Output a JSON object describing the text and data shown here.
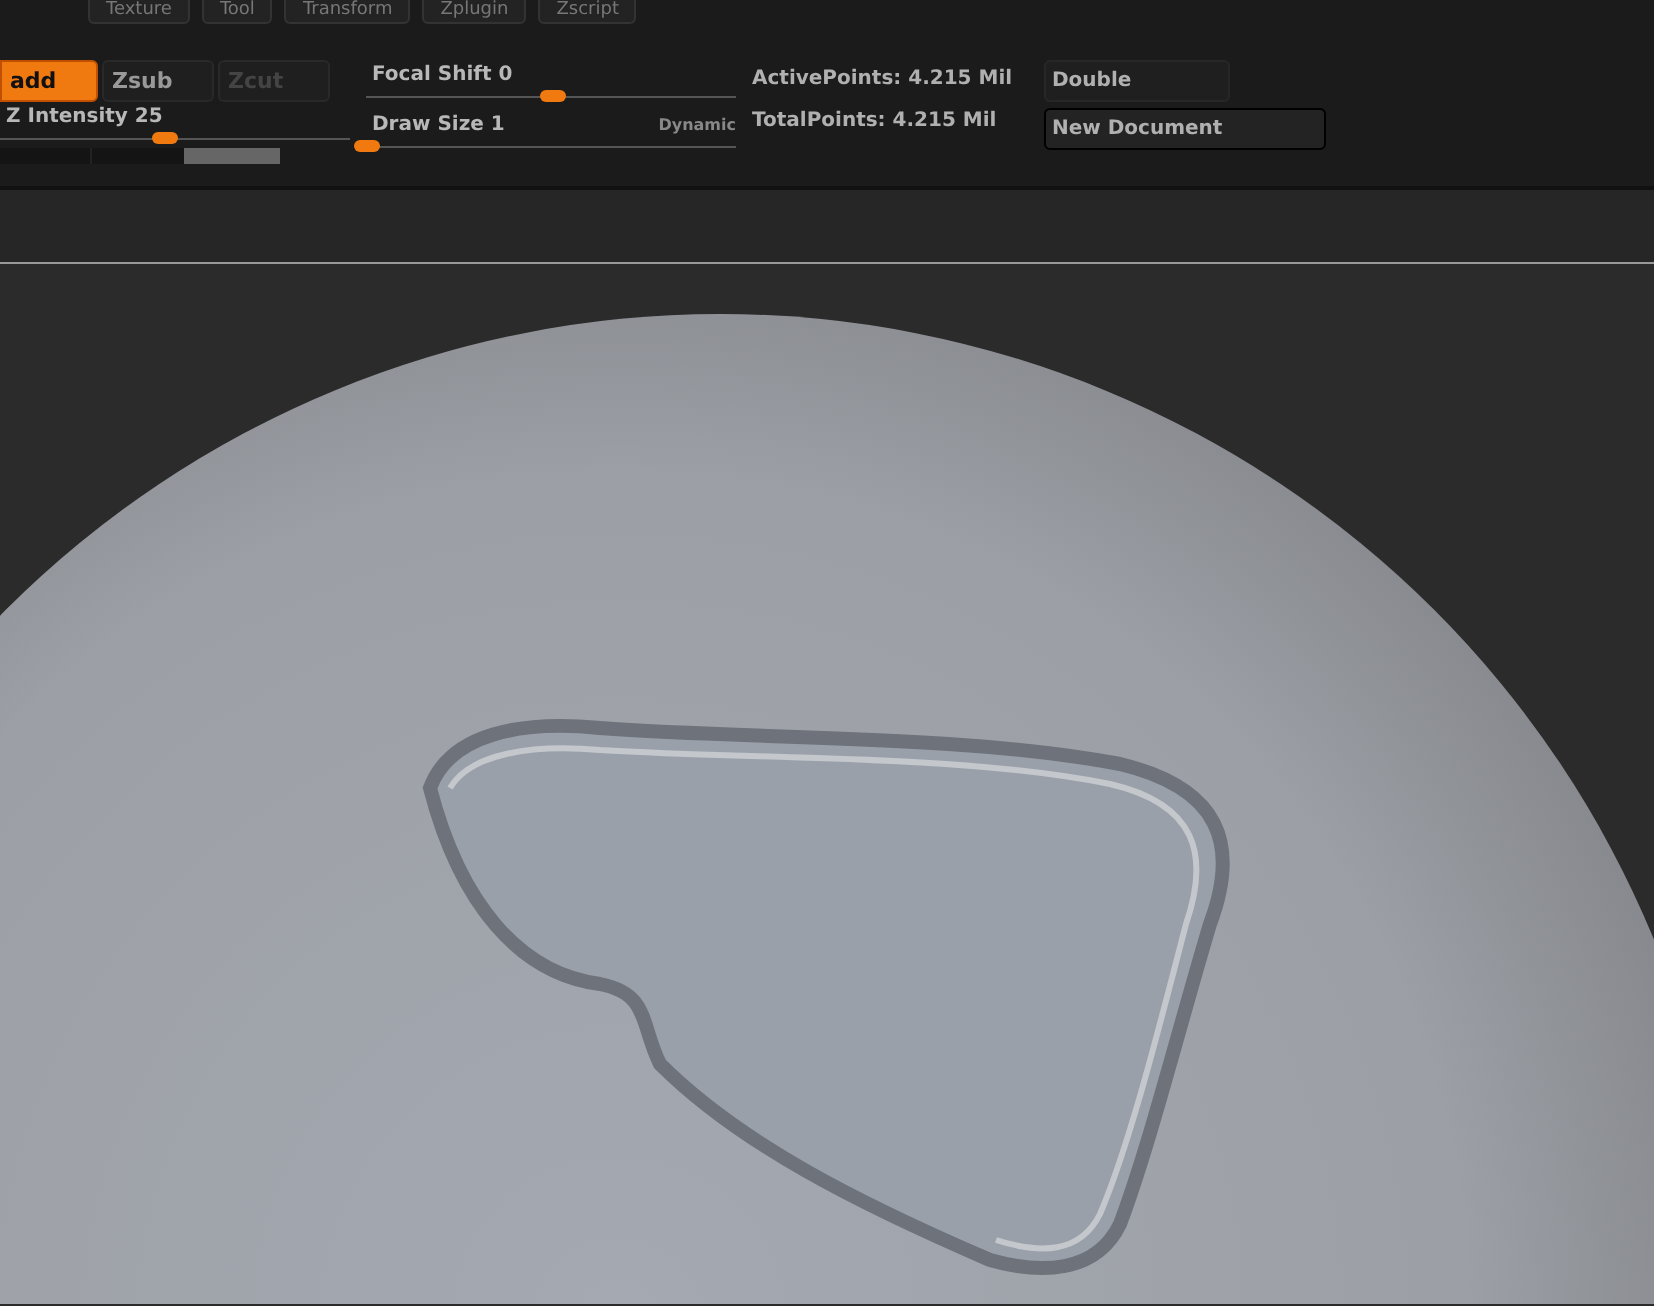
{
  "menu": [
    "Texture",
    "Tool",
    "Transform",
    "Zplugin",
    "Zscript"
  ],
  "modes": [
    {
      "label": "add",
      "selected": true,
      "disabled": false
    },
    {
      "label": "Zsub",
      "selected": false,
      "disabled": false
    },
    {
      "label": "Zcut",
      "selected": false,
      "disabled": true
    }
  ],
  "z_intensity": {
    "label": "Z Intensity 25",
    "level": 0.47
  },
  "focal_shift": {
    "label": "Focal Shift 0",
    "level": 0.5
  },
  "draw_size": {
    "label": "Draw Size 1",
    "level": 0.0,
    "dynamic": "Dynamic"
  },
  "status_bar": {
    "level": 0.34
  },
  "stats": [
    "ActivePoints: 4.215 Mil",
    "TotalPoints: 4.215 Mil"
  ],
  "buttons": [
    "Double",
    "New Document"
  ]
}
